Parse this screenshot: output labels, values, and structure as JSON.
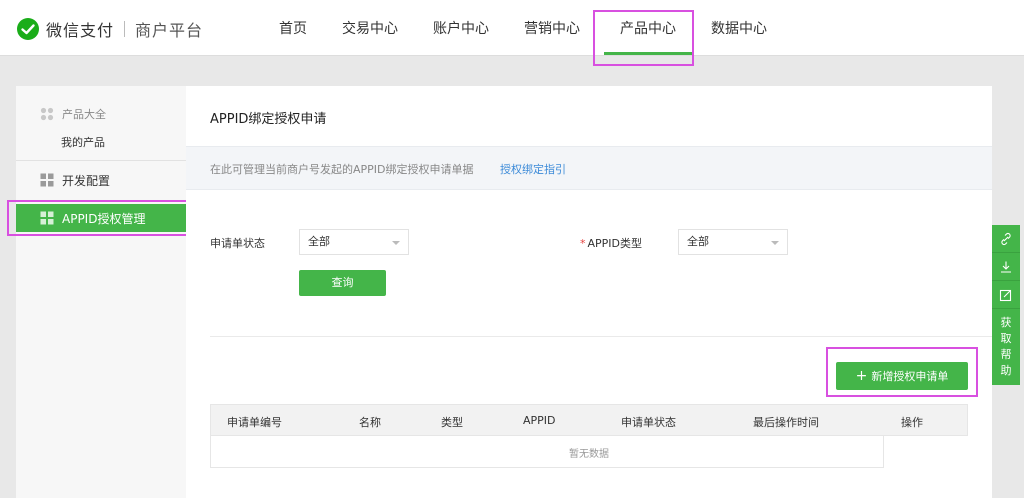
{
  "header": {
    "brand": "微信支付",
    "platform": "商户平台",
    "nav": [
      {
        "label": "首页",
        "active": false
      },
      {
        "label": "交易中心",
        "active": false
      },
      {
        "label": "账户中心",
        "active": false
      },
      {
        "label": "营销中心",
        "active": false
      },
      {
        "label": "产品中心",
        "active": true
      },
      {
        "label": "数据中心",
        "active": false
      }
    ]
  },
  "sidebar": {
    "group_title": "产品大全",
    "group_sub": "我的产品",
    "items": [
      {
        "label": "开发配置",
        "active": false
      },
      {
        "label": "APPID授权管理",
        "active": true
      }
    ]
  },
  "main": {
    "title": "APPID绑定授权申请",
    "info_text": "在此可管理当前商户号发起的APPID绑定授权申请单据",
    "info_link": "授权绑定指引",
    "filters": {
      "status_label": "申请单状态",
      "status_value": "全部",
      "type_required": "*",
      "type_label": "APPID类型",
      "type_value": "全部"
    },
    "query_button": "查询",
    "add_button": "新增授权申请单",
    "table": {
      "headers": [
        "申请单编号",
        "名称",
        "类型",
        "APPID",
        "申请单状态",
        "最后操作时间",
        "操作"
      ],
      "empty_text": "暂无数据"
    }
  },
  "float_bar": {
    "help_chars": [
      "获",
      "取",
      "帮",
      "助"
    ]
  },
  "colors": {
    "accent": "#44b549",
    "highlight": "#d850e0",
    "link": "#3d8bd8"
  }
}
